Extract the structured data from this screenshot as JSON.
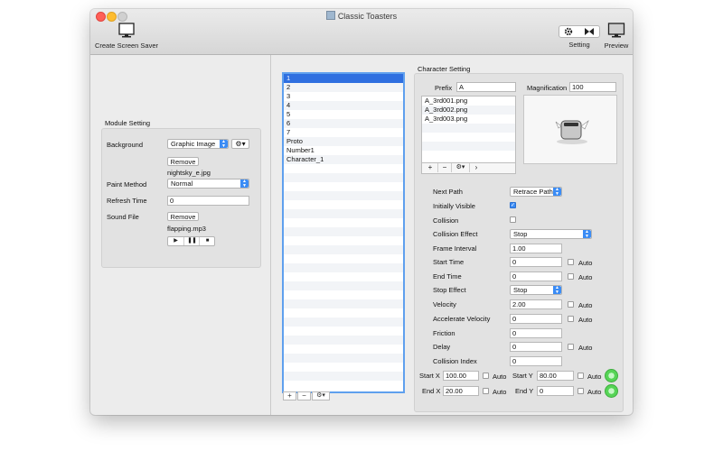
{
  "window": {
    "title": "Classic Toasters",
    "traffic_lights": {
      "close": "#ff5f57",
      "minimize": "#febc2e",
      "zoom": "#d0d0d0"
    }
  },
  "toolbar": {
    "create_label": "Create Screen Saver",
    "setting_label": "Setting",
    "preview_label": "Preview"
  },
  "module_setting": {
    "title": "Module Setting",
    "background_label": "Background",
    "background_value": "Graphic Image",
    "remove_label": "Remove",
    "background_file": "nightsky_e.jpg",
    "paint_method_label": "Paint Method",
    "paint_method_value": "Normal",
    "refresh_time_label": "Refresh Time",
    "refresh_time_value": "0",
    "sound_file_label": "Sound File",
    "sound_remove_label": "Remove",
    "sound_file": "flapping.mp3"
  },
  "items": [
    "1",
    "2",
    "3",
    "4",
    "5",
    "6",
    "7",
    "Proto",
    "Number1",
    "Character_1"
  ],
  "character_setting": {
    "title": "Character Setting",
    "prefix_label": "Prefix",
    "prefix_value": "A",
    "magnification_label": "Magnification",
    "magnification_value": "100",
    "files": [
      "A_3rd001.png",
      "A_3rd002.png",
      "A_3rd003.png"
    ],
    "next_path_label": "Next Path",
    "next_path_value": "Retrace Path",
    "initially_visible_label": "Initially Visible",
    "initially_visible": true,
    "collision_label": "Collision",
    "collision": false,
    "collision_effect_label": "Collision Effect",
    "collision_effect_value": "Stop",
    "frame_interval_label": "Frame Interval",
    "frame_interval_value": "1.00",
    "start_time_label": "Start Time",
    "start_time_value": "0",
    "end_time_label": "End Time",
    "end_time_value": "0",
    "stop_effect_label": "Stop Effect",
    "stop_effect_value": "Stop",
    "velocity_label": "Velocity",
    "velocity_value": "2.00",
    "accel_label": "Accelerate Velocity",
    "accel_value": "0",
    "friction_label": "Friction",
    "friction_value": "0",
    "delay_label": "Delay",
    "delay_value": "0",
    "collision_index_label": "Collision Index",
    "collision_index_value": "0",
    "auto_label": "Auto",
    "start_x_label": "Start X",
    "start_x_value": "100.00",
    "start_y_label": "Start Y",
    "start_y_value": "80.00",
    "end_x_label": "End X",
    "end_x_value": "20.00",
    "end_y_label": "End Y",
    "end_y_value": "0"
  },
  "accent_color": "#3b8cf5",
  "selection_color": "#2f6fe0"
}
